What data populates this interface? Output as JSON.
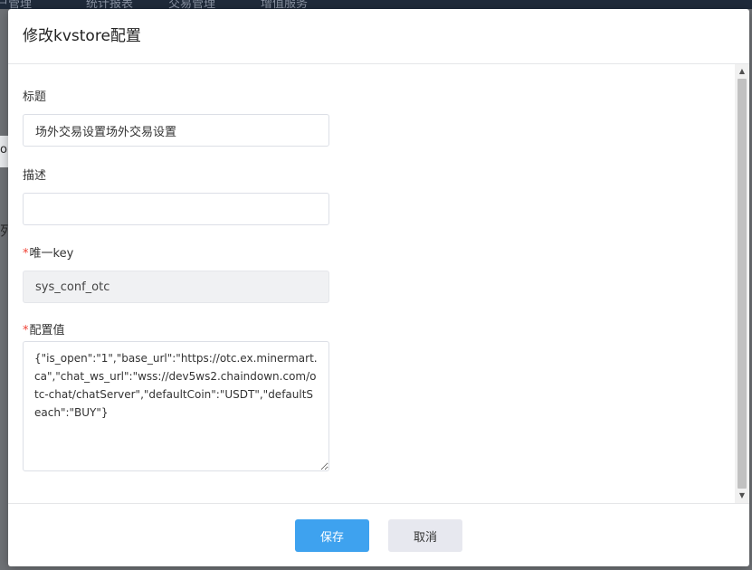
{
  "background": {
    "top_nav": [
      "户管理",
      "统计报表",
      "交易管理",
      "增值服务"
    ],
    "left_fragments": [
      "o",
      "列"
    ]
  },
  "dialog": {
    "title": "修改kvstore配置",
    "fields": {
      "title": {
        "label": "标题",
        "value": "场外交易设置场外交易设置",
        "required": false
      },
      "description": {
        "label": "描述",
        "value": "",
        "required": false
      },
      "unique_key": {
        "label": "唯一key",
        "value": "sys_conf_otc",
        "required": true,
        "disabled": true
      },
      "config_value": {
        "label": "配置值",
        "value": "{\"is_open\":\"1\",\"base_url\":\"https://otc.ex.minermart.ca\",\"chat_ws_url\":\"wss://dev5ws2.chaindown.com/otc-chat/chatServer\",\"defaultCoin\":\"USDT\",\"defaultSeach\":\"BUY\"}",
        "required": true
      }
    },
    "required_mark": "*",
    "buttons": {
      "save": "保存",
      "cancel": "取消"
    }
  },
  "colors": {
    "primary": "#3ea2ef",
    "required": "#f04134",
    "cancel_bg": "#e7e8ef"
  }
}
